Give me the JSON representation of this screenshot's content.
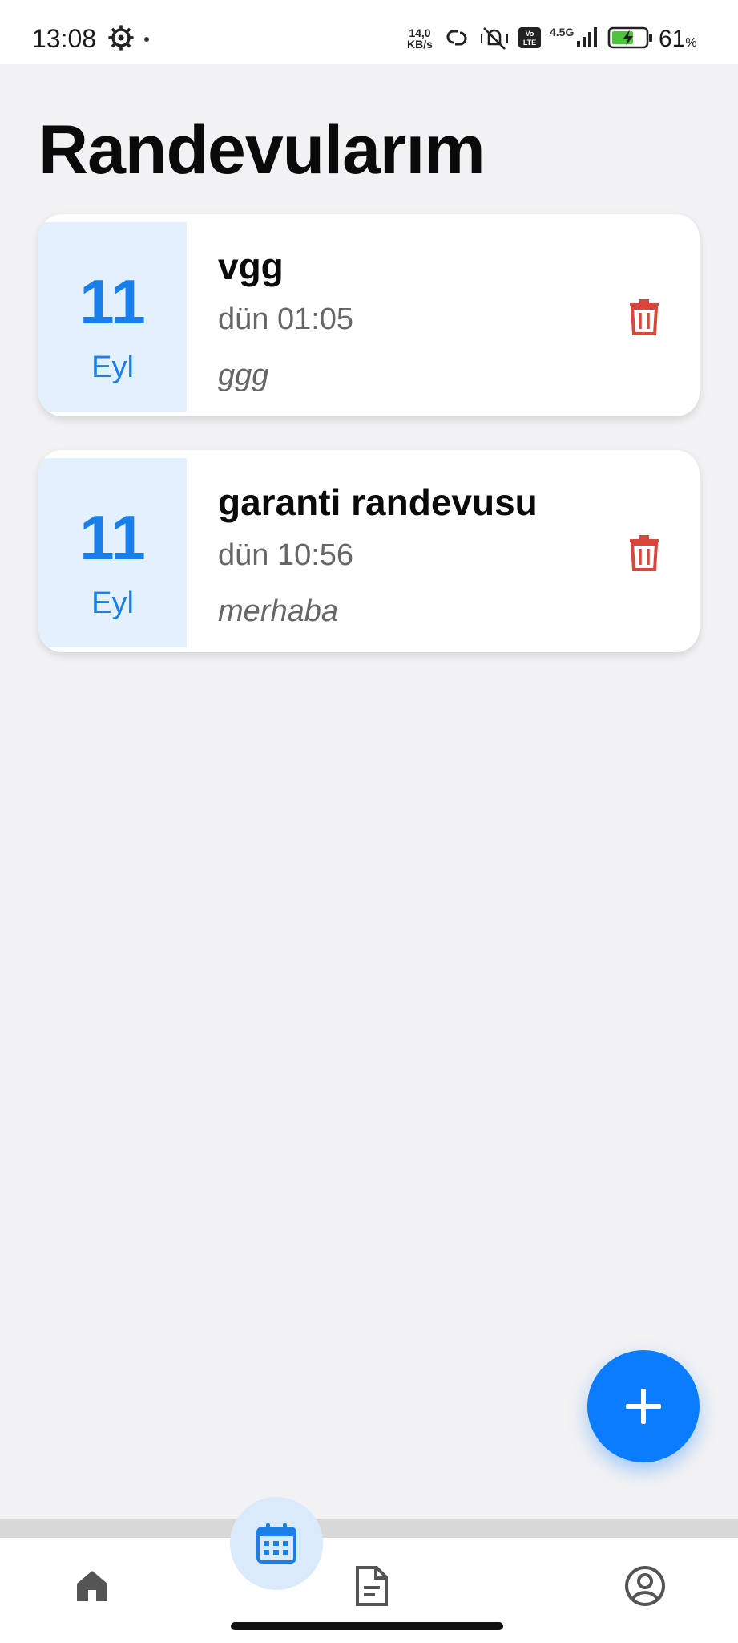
{
  "status_bar": {
    "time": "13:08",
    "net_speed_value": "14,0",
    "net_speed_unit": "KB/s",
    "network_type": "4.5G",
    "battery_percent": "61",
    "battery_unit": "%"
  },
  "page": {
    "title": "Randevularım"
  },
  "appointments": [
    {
      "day": "11",
      "month": "Eyl",
      "title": "vgg",
      "time": "dün 01:05",
      "note": "ggg"
    },
    {
      "day": "11",
      "month": "Eyl",
      "title": "garanti randevusu",
      "time": "dün 10:56",
      "note": "merhaba"
    }
  ],
  "icons": {
    "delete": "trash-icon",
    "add": "plus-icon",
    "nav": [
      "home-icon",
      "calendar-icon",
      "document-icon",
      "profile-icon"
    ]
  },
  "colors": {
    "accent": "#0a7cff",
    "date_bg": "#e3f0fd",
    "delete": "#d9473b",
    "background": "#f2f2f4"
  },
  "bottom_nav": {
    "active_index": 1
  }
}
